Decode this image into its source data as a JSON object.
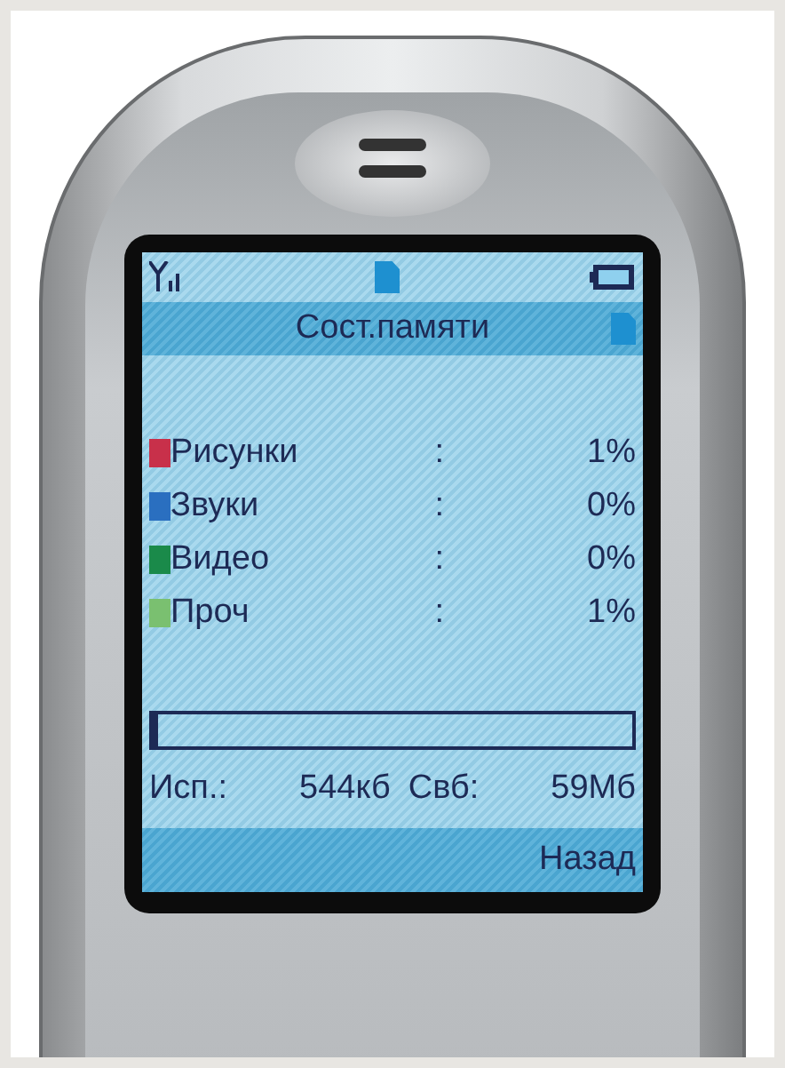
{
  "screen": {
    "title": "Сост.памяти",
    "categories": [
      {
        "label": "Рисунки",
        "separator": ":",
        "value": "1%",
        "color": "#c8304a"
      },
      {
        "label": "Звуки",
        "separator": ":",
        "value": "0%",
        "color": "#2a6fc0"
      },
      {
        "label": "Видео",
        "separator": ":",
        "value": "0%",
        "color": "#1a8a4a"
      },
      {
        "label": "Проч",
        "separator": ":",
        "value": "1%",
        "color": "#7ac070"
      }
    ],
    "usage": {
      "level": 0.01,
      "used_label": "Исп.:",
      "used_value": "544кб",
      "free_label": "Свб:",
      "free_value": "59Мб"
    },
    "softkey": "Назад"
  }
}
